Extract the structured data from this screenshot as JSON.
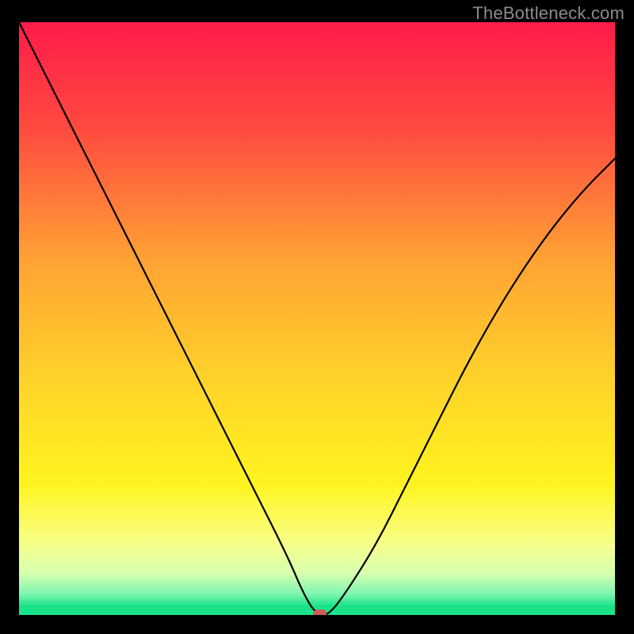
{
  "watermark": "TheBottleneck.com",
  "chart_data": {
    "type": "line",
    "title": "",
    "xlabel": "",
    "ylabel": "",
    "xlim": [
      0,
      100
    ],
    "ylim": [
      0,
      100
    ],
    "grid": false,
    "background_gradient_stops": [
      {
        "offset": 0.0,
        "color": "#ff1b4a"
      },
      {
        "offset": 0.18,
        "color": "#ff4a3f"
      },
      {
        "offset": 0.4,
        "color": "#ffa234"
      },
      {
        "offset": 0.6,
        "color": "#ffd22a"
      },
      {
        "offset": 0.78,
        "color": "#fff41f"
      },
      {
        "offset": 0.88,
        "color": "#f8ff8a"
      },
      {
        "offset": 0.93,
        "color": "#d6ffb0"
      },
      {
        "offset": 0.965,
        "color": "#7cf5b0"
      },
      {
        "offset": 0.985,
        "color": "#18e389"
      },
      {
        "offset": 1.0,
        "color": "#18e389"
      }
    ],
    "series": [
      {
        "name": "bottleneck-curve",
        "color": "#000000",
        "x": [
          0,
          5,
          10,
          15,
          20,
          25,
          30,
          35,
          40,
          45,
          48,
          50,
          52,
          55,
          60,
          65,
          70,
          75,
          80,
          85,
          90,
          95,
          100
        ],
        "y": [
          100,
          90,
          80,
          70,
          60,
          50,
          40,
          30,
          20,
          10,
          3,
          0,
          0,
          4,
          12,
          22,
          32,
          42,
          51,
          59,
          66,
          72,
          77
        ]
      }
    ],
    "marker": {
      "name": "result-marker",
      "x": 50.5,
      "y": 0,
      "width_pct": 2.2,
      "height_pct": 1.3,
      "color": "#cf5b5b"
    }
  }
}
